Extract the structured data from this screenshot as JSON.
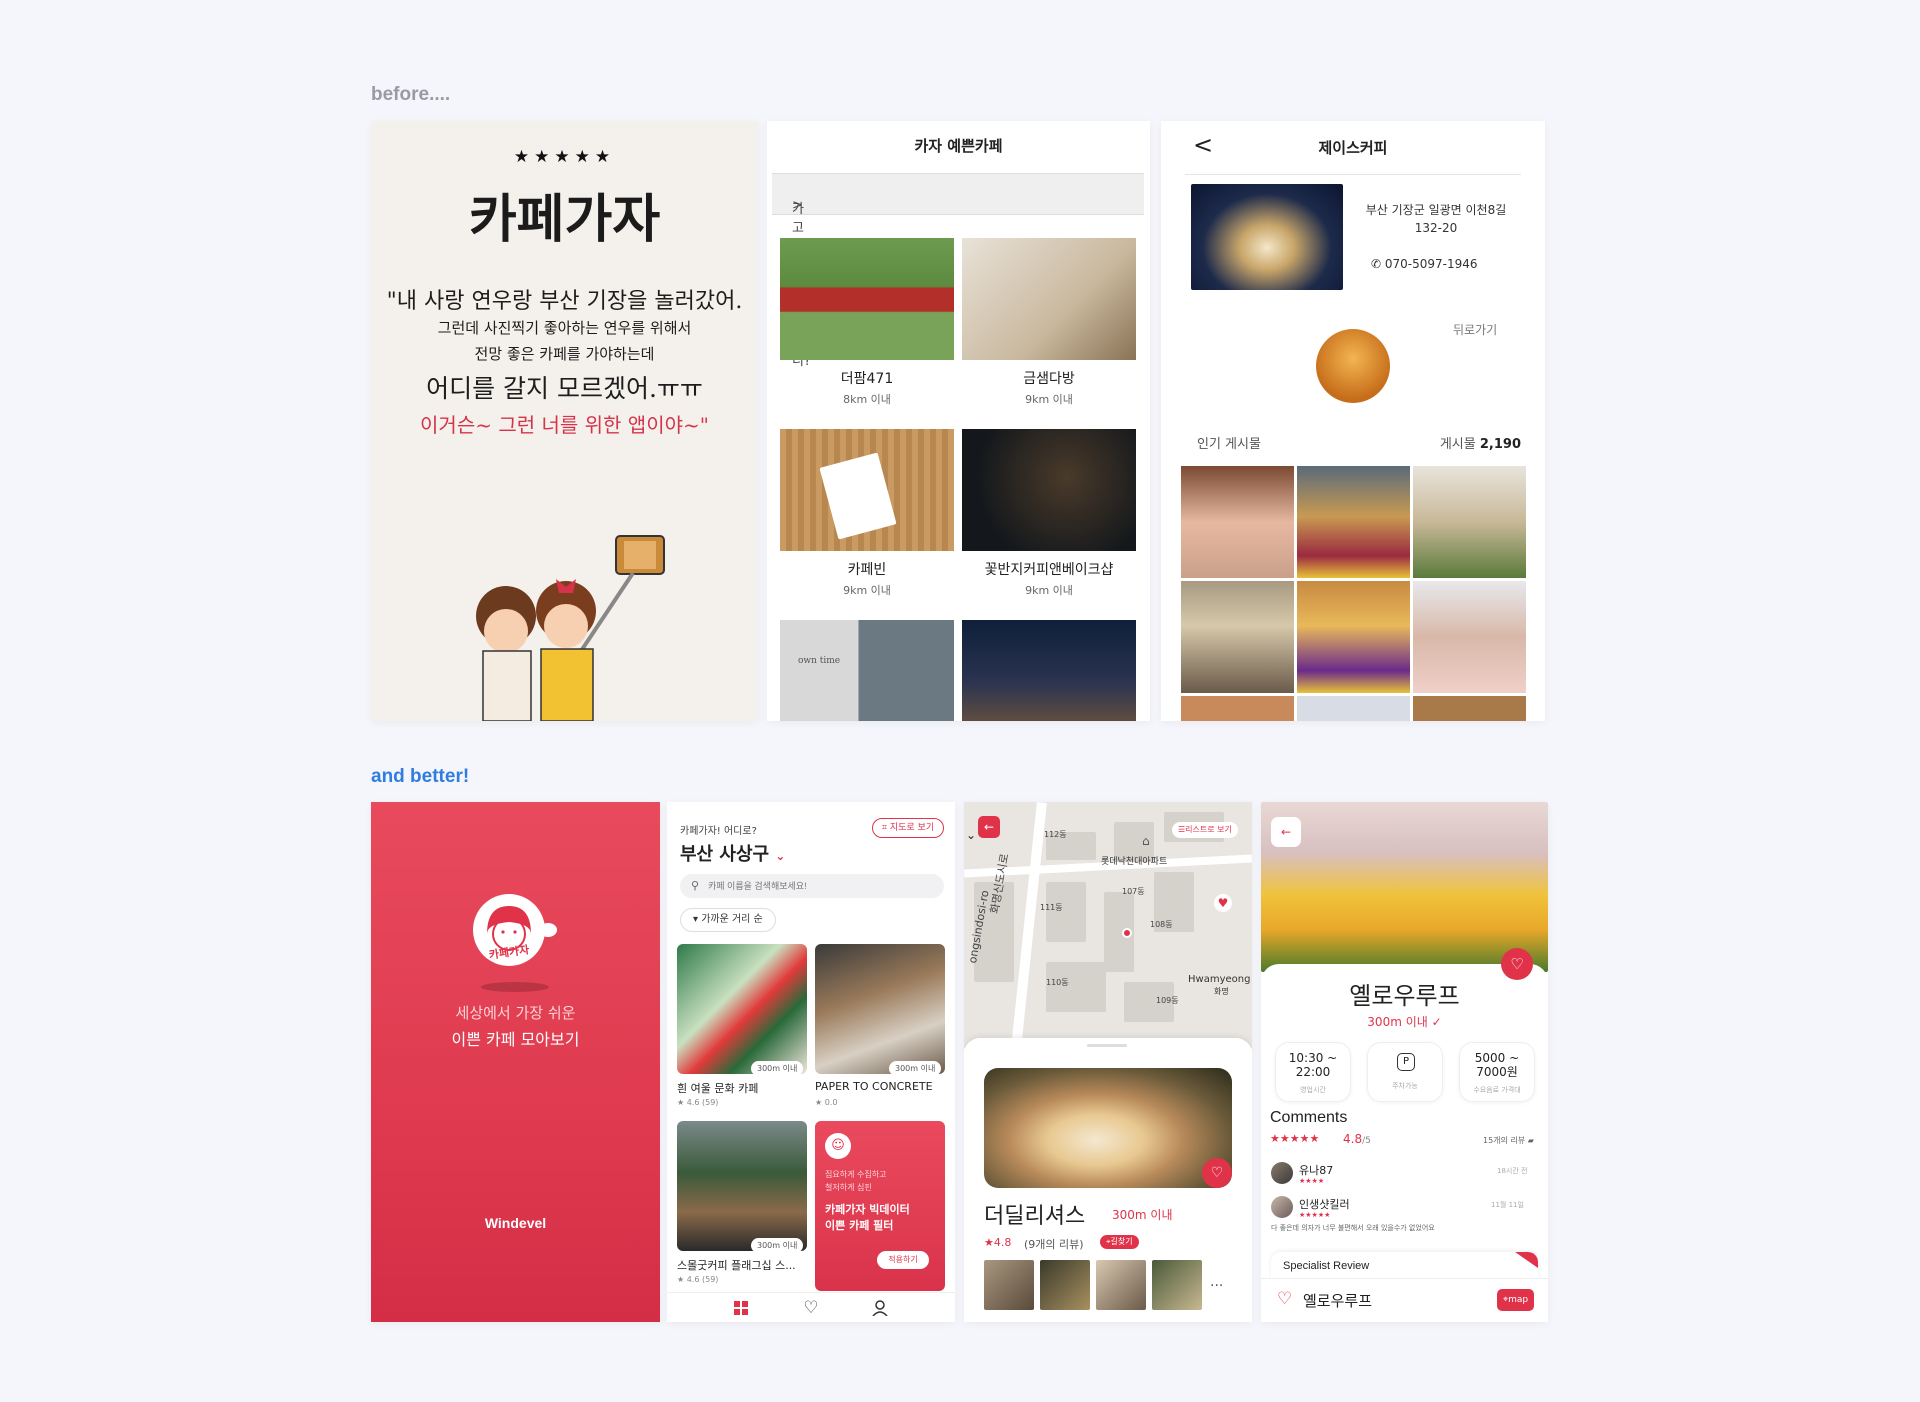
{
  "labels": {
    "before": "before....",
    "after": "and better!"
  },
  "before_splash": {
    "stars": "★★★★★",
    "logo": "카페가자",
    "line1": "\"내 사랑 연우랑 부산 기장을 놀러갔어.",
    "line2": "그런데 사진찍기 좋아하는 연우를 위해서",
    "line3": "전망 좋은 카페를 가야하는데",
    "line4": "어디를 갈지 모르겠어.ㅠㅠ",
    "line5": "이거슨~ 그런 너를 위한 앱이야~\""
  },
  "before_list": {
    "title": "카자 예쁜카페",
    "region_prompt": "가고 싶은 지역이 있니?",
    "chevron": ">",
    "items": [
      {
        "name": "더팜471",
        "dist": "8km 이내"
      },
      {
        "name": "금샘다방",
        "dist": "9km 이내"
      },
      {
        "name": "카페빈",
        "dist": "9km 이내"
      },
      {
        "name": "꽃반지커피앤베이크샵",
        "dist": "9km 이내"
      }
    ],
    "sign_text": "own time"
  },
  "before_detail": {
    "title": "제이스커피",
    "back": "<",
    "address": "부산 기장군 일광면 이천8길 132-20",
    "phone": "070-5097-1946",
    "back_link": "뒤로가기",
    "popular": "인기 게시물",
    "posts_label": "게시물",
    "posts_count": "2,190"
  },
  "after_splash": {
    "logo_text": "카페가자",
    "sub1": "세상에서 가장 쉬운",
    "sub2": "이쁜 카페 모아보기",
    "brand": "Windevel"
  },
  "after_list": {
    "question": "카페가자! 어디로?",
    "location": "부산 사상구",
    "chevron": "⌄",
    "map_button": "지도로 보기",
    "search_placeholder": "카페 이름을 검색해보세요!",
    "sort": "▾ 가까운 거리 순",
    "cards": [
      {
        "name": "흰 여울 문화 카페",
        "tag": "300m 이내",
        "rating": "★ 4.6 (59)"
      },
      {
        "name": "PAPER TO CONCRETE",
        "tag": "300m 이내",
        "rating": "★ 0.0"
      },
      {
        "name": "스몰굿커피 플래그십 스...",
        "tag": "300m 이내",
        "rating": "★ 4.6 (59)"
      }
    ],
    "promo": {
      "line1": "집요하게 수집하고",
      "line2": "철저하게 심핀",
      "line3": "카페가자 빅데이터",
      "line4": "이쁜 카페 필터",
      "button": "적용하기"
    }
  },
  "after_map": {
    "list_button": "리스트로 보기",
    "labels": [
      "112동",
      "롯데낙천대아파트",
      "107동",
      "111동",
      "108동",
      "110동",
      "109동",
      "Hwamyeong",
      "화명",
      "ongsindosi-ro",
      "화명신도시로"
    ],
    "cafe_name": "더딜리셔스",
    "distance": "300m 이내",
    "rating": "★4.8",
    "reviews": "(9개의 리뷰)",
    "directions": "길찾기",
    "more": "..."
  },
  "after_detail": {
    "name": "옐로우루프",
    "distance": "300m 이내",
    "hours": "10:30 ~ 22:00",
    "hours_label": "영업시간",
    "parking_label": "주차가능",
    "parking_icon": "P",
    "price": "5000 ~ 7000원",
    "price_label": "수요음료 가격대",
    "comments_title": "Comments",
    "stars": "★★★★★",
    "score": "4.8",
    "score_max": "/5",
    "review_count": "15개의 리뷰",
    "reviews": [
      {
        "user": "유나87",
        "stars": "★★★★",
        "date": "18시간 전"
      },
      {
        "user": "인생샷킬러",
        "stars": "★★★★★",
        "date": "11월 11일"
      }
    ],
    "review_text": "다 좋은데 의자가 너무 불편해서 오래 있을수가 없었어요",
    "specialist": "Specialist Review",
    "footer_name": "옐로우루프",
    "map_button": "map"
  },
  "colors": {
    "brand": "#e0334a",
    "accent_blue": "#2f7de1",
    "bg": "#f5f6fb"
  }
}
